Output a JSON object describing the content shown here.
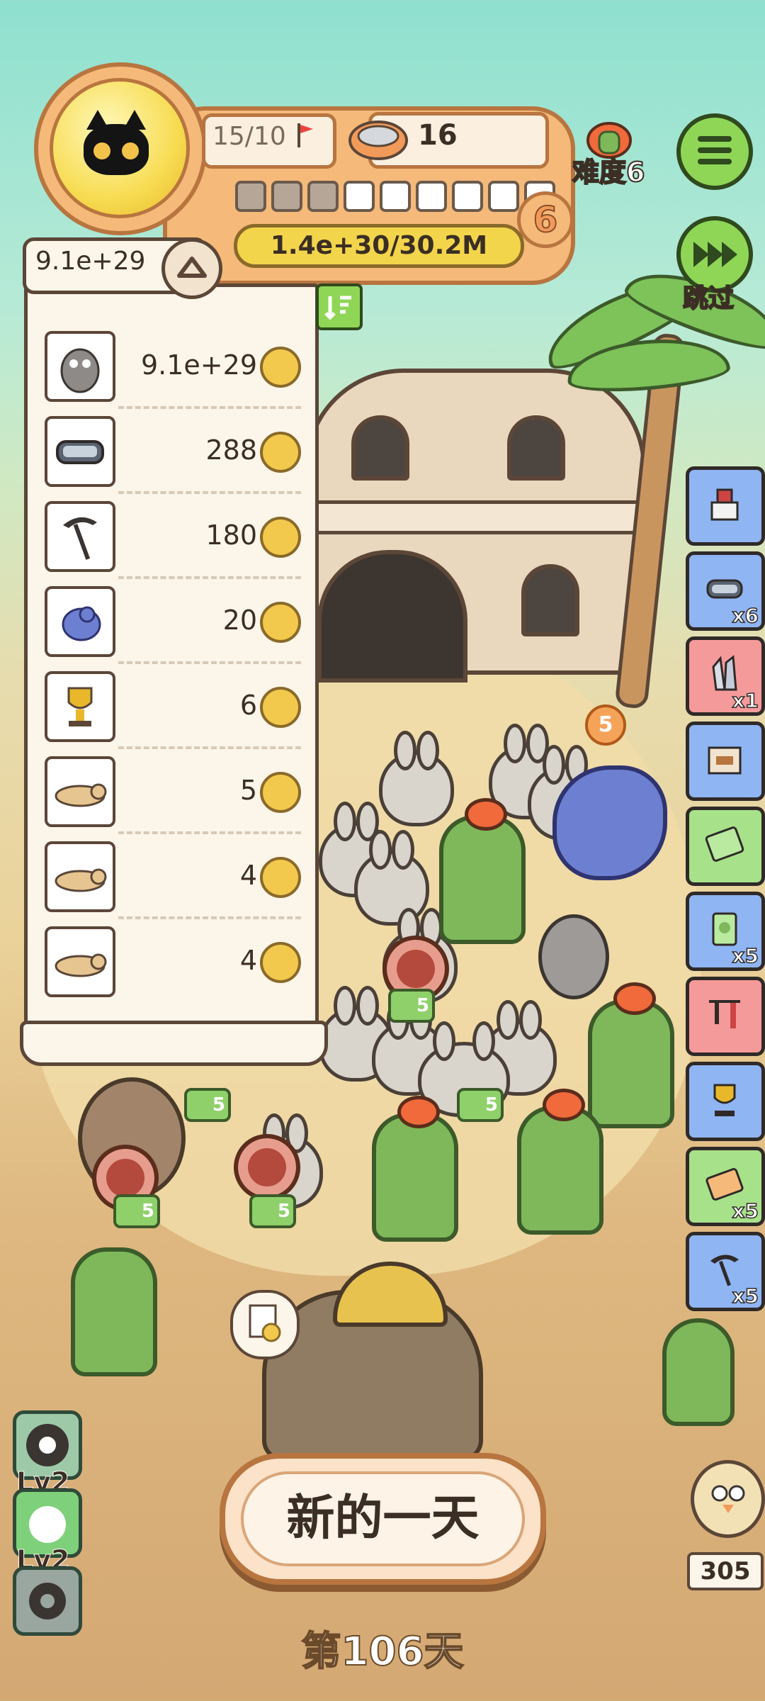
{
  "hud": {
    "capacity": "15/10",
    "coins": "16",
    "level": "6",
    "exp": "1.4e+30/30.2M",
    "segments_filled": 3,
    "segments_total": 9,
    "difficulty": "难度6",
    "skip_label": "跳过"
  },
  "inventory": {
    "total": "9.1e+29",
    "rows": [
      {
        "icon": "owl-icon",
        "value": "9.1e+29"
      },
      {
        "icon": "goggles-icon",
        "value": "288"
      },
      {
        "icon": "scythe-icon",
        "value": "180"
      },
      {
        "icon": "dragon-icon",
        "value": "20"
      },
      {
        "icon": "trophy-icon",
        "value": "6"
      },
      {
        "icon": "lizard-icon",
        "value": "5"
      },
      {
        "icon": "lizard-icon",
        "value": "4"
      },
      {
        "icon": "lizard-icon",
        "value": "4"
      }
    ]
  },
  "side_items": [
    {
      "icon": "grinder-icon",
      "color": "blue",
      "count": ""
    },
    {
      "icon": "goggles-icon",
      "color": "blue",
      "count": "x6"
    },
    {
      "icon": "crystal-icon",
      "color": "red",
      "count": "x1"
    },
    {
      "icon": "chest-icon",
      "color": "blue",
      "count": ""
    },
    {
      "icon": "ticket-icon",
      "color": "green",
      "count": ""
    },
    {
      "icon": "clover-card-icon",
      "color": "blue",
      "count": "x5"
    },
    {
      "icon": "tools-icon",
      "color": "red",
      "count": ""
    },
    {
      "icon": "trophy-icon",
      "color": "blue",
      "count": ""
    },
    {
      "icon": "refresh-ticket-icon",
      "color": "green",
      "count": "x5"
    },
    {
      "icon": "scythe-icon",
      "color": "blue",
      "count": "x5"
    }
  ],
  "field_badges": [
    "5",
    "5",
    "5",
    "5",
    "5",
    "5"
  ],
  "bottom": {
    "skill1_level": "Lv2",
    "skill2_level": "Lv2",
    "new_day": "新的一天",
    "day": "第106天",
    "bird_count": "305"
  },
  "colors": {
    "accent_green": "#8fd657",
    "panel_orange": "#f5b97a",
    "exp_yellow": "#f3d54b"
  }
}
